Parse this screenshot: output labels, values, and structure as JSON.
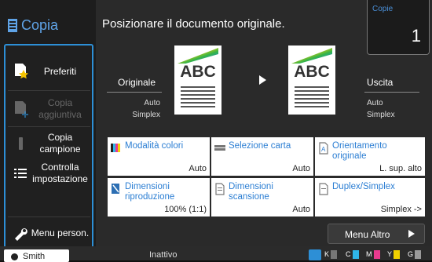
{
  "app": {
    "title": "Copia"
  },
  "sidebar": {
    "items": [
      {
        "label": "Preferiti",
        "icon": "favorite-document-icon",
        "enabled": true
      },
      {
        "label": "Copia aggiuntiva",
        "icon": "copy-add-icon",
        "enabled": false
      },
      {
        "label": "Copia campione",
        "icon": "sample-copy-icon",
        "enabled": true
      },
      {
        "label": "Controlla impostazione",
        "icon": "list-icon",
        "enabled": true
      },
      {
        "label": "Menu person.",
        "icon": "wrench-icon",
        "enabled": true
      }
    ]
  },
  "main": {
    "instruction": "Posizionare il documento originale.",
    "copies": {
      "label": "Copie",
      "value": "1"
    },
    "original": {
      "label": "Originale",
      "line1": "Auto",
      "line2": "Simplex",
      "doc_text": "ABC"
    },
    "output": {
      "label": "Uscita",
      "line1": "Auto",
      "line2": "Simplex",
      "doc_text": "ABC"
    },
    "buttons": [
      {
        "label": "Modalità colori",
        "value": "Auto",
        "icon": "color-mode-icon"
      },
      {
        "label": "Selezione carta",
        "value": "Auto",
        "icon": "paper-tray-icon"
      },
      {
        "label": "Orientamento originale",
        "value": "L. sup. alto",
        "icon": "orientation-icon"
      },
      {
        "label": "Dimensioni riproduzione",
        "value": "100% (1:1)",
        "icon": "reproduction-size-icon"
      },
      {
        "label": "Dimensioni scansione",
        "value": "Auto",
        "icon": "scan-size-icon"
      },
      {
        "label": "Duplex/Simplex",
        "value": "Simplex ->",
        "icon": "duplex-icon"
      }
    ],
    "more_menu": "Menu Altro"
  },
  "statusbar": {
    "user": "Smith",
    "status": "Inattivo",
    "inks": [
      {
        "label": "K",
        "color": "#777777"
      },
      {
        "label": "C",
        "color": "#2fb5e8"
      },
      {
        "label": "M",
        "color": "#e83a8e"
      },
      {
        "label": "Y",
        "color": "#f2d200"
      },
      {
        "label": "G",
        "color": "#9a9a9a"
      }
    ]
  },
  "colors": {
    "accent": "#2d8fd6",
    "title": "#5fa3e6",
    "button_text": "#2b7ed3"
  }
}
